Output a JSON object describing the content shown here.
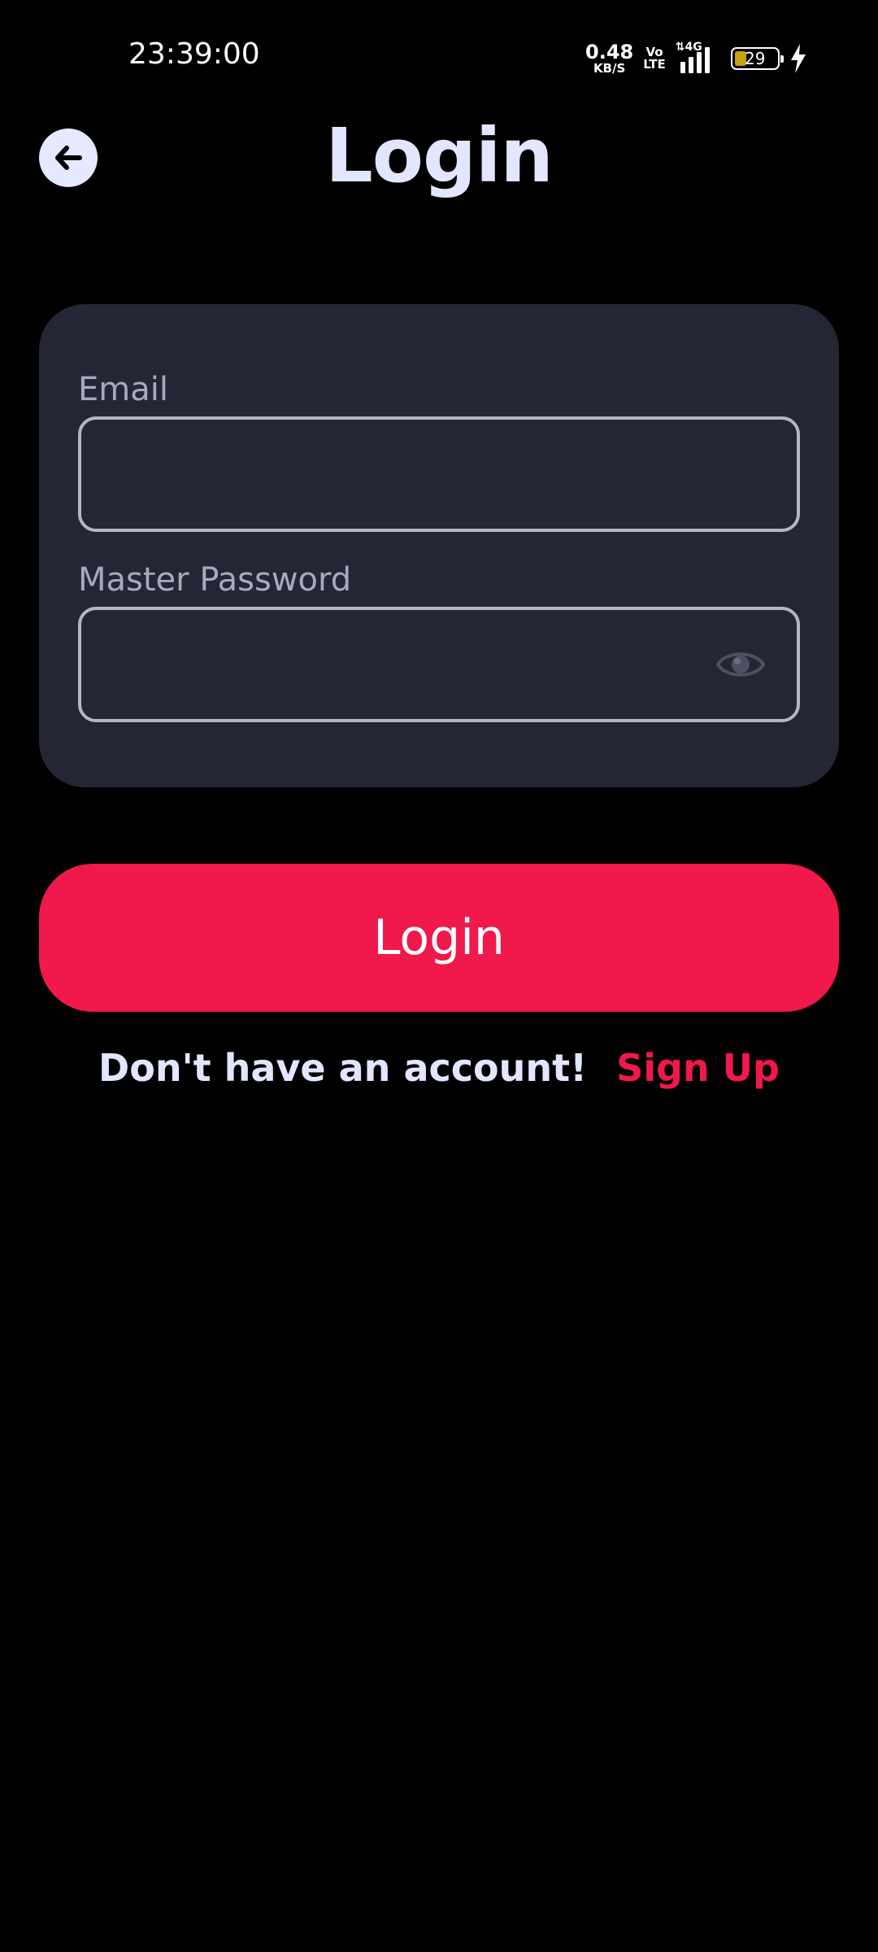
{
  "status_bar": {
    "time": "23:39:00",
    "net_speed_value": "0.48",
    "net_speed_unit": "KB/S",
    "volte_top": "Vo",
    "volte_bottom": "LTE",
    "network_type": "4G",
    "battery_level": "29",
    "battery_color": "#c8a10f",
    "charging": true
  },
  "header": {
    "title": "Login",
    "back_icon": "arrow-left-icon"
  },
  "form": {
    "email_label": "Email",
    "email_value": "",
    "password_label": "Master Password",
    "password_value": "",
    "password_toggle_icon": "eye-icon"
  },
  "actions": {
    "login_label": "Login",
    "signup_prompt": "Don't have an account!",
    "signup_link": "Sign Up"
  },
  "colors": {
    "background": "#000000",
    "card": "#242633",
    "accent": "#f1184b",
    "title_text": "#e3e6ff",
    "label_text": "#a7a9c0",
    "field_border": "#b3b5c8"
  }
}
